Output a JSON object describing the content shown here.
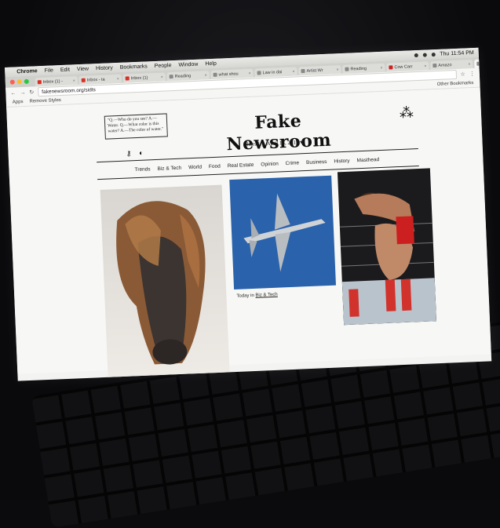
{
  "menubar": {
    "app": "Chrome",
    "items": [
      "File",
      "Edit",
      "View",
      "History",
      "Bookmarks",
      "People",
      "Window",
      "Help"
    ],
    "clock": "Thu 11:54 PM"
  },
  "tabs": [
    {
      "label": "Inbox (1) -",
      "color": "#d93025"
    },
    {
      "label": "Inbox - ta",
      "color": "#d93025"
    },
    {
      "label": "Inbox (1)",
      "color": "#d93025"
    },
    {
      "label": "Reading",
      "color": "#888888"
    },
    {
      "label": "what shou",
      "color": "#888888"
    },
    {
      "label": "Law in dai",
      "color": "#888888"
    },
    {
      "label": "Artist Wr",
      "color": "#888888"
    },
    {
      "label": "Reading",
      "color": "#888888"
    },
    {
      "label": "Cow Carr",
      "color": "#cc2222"
    },
    {
      "label": "Amazo",
      "color": "#888888"
    },
    {
      "label": "Fake New",
      "color": "#888888"
    }
  ],
  "browser": {
    "url": "fakenewsroom.org/sidts",
    "bookmarks": [
      "Apps",
      "Remove Styles"
    ],
    "other_bookmarks": "Other Bookmarks"
  },
  "site": {
    "title": "Fake Newsroom",
    "date": "Thursday, April 13, 2017",
    "quote": "\"Q.—Who do you see? A.—Water. Q.—What color is this water? A.—The color of water.\"",
    "nav": [
      "Trends",
      "Biz & Tech",
      "World",
      "Food",
      "Real Estate",
      "Opinion",
      "Crime",
      "Business",
      "History",
      "Masthead"
    ],
    "caption_prefix": "Today in",
    "caption_link": "Biz & Tech"
  }
}
